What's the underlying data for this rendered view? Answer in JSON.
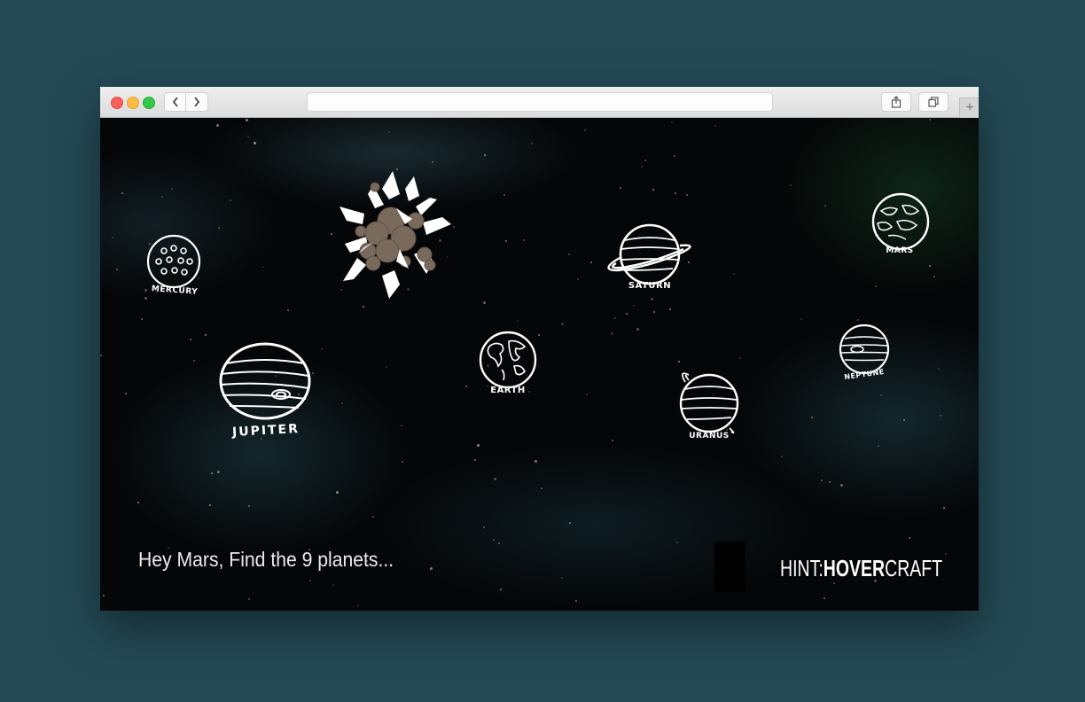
{
  "browser": {
    "address": "",
    "back_icon": "chevron-left-icon",
    "forward_icon": "chevron-right-icon",
    "share_icon": "share-icon",
    "tabs_icon": "tabs-overview-icon",
    "new_tab_label": "+"
  },
  "game": {
    "message": "Hey Mars, Find the 9 planets...",
    "hint": {
      "prefix": "HINT",
      "separator": ":",
      "bold": "HOVER",
      "thin": "CRAFT"
    },
    "planets": [
      {
        "name": "MERCURY",
        "label": "MERCURY"
      },
      {
        "name": "JUPITER",
        "label": "JUPITER"
      },
      {
        "name": "EARTH",
        "label": "EARTH"
      },
      {
        "name": "SATURN",
        "label": "SATURN"
      },
      {
        "name": "URANUS",
        "label": "URANUS"
      },
      {
        "name": "NEPTUNE",
        "label": "NEPTUNE"
      },
      {
        "name": "MARS",
        "label": "MARS"
      }
    ],
    "explosion_icon": "exploded-planet-icon"
  },
  "colors": {
    "page_background": "#244a55",
    "space_background": "#050607",
    "planet_line": "#ffffff",
    "debris": "#7a6a5c"
  }
}
